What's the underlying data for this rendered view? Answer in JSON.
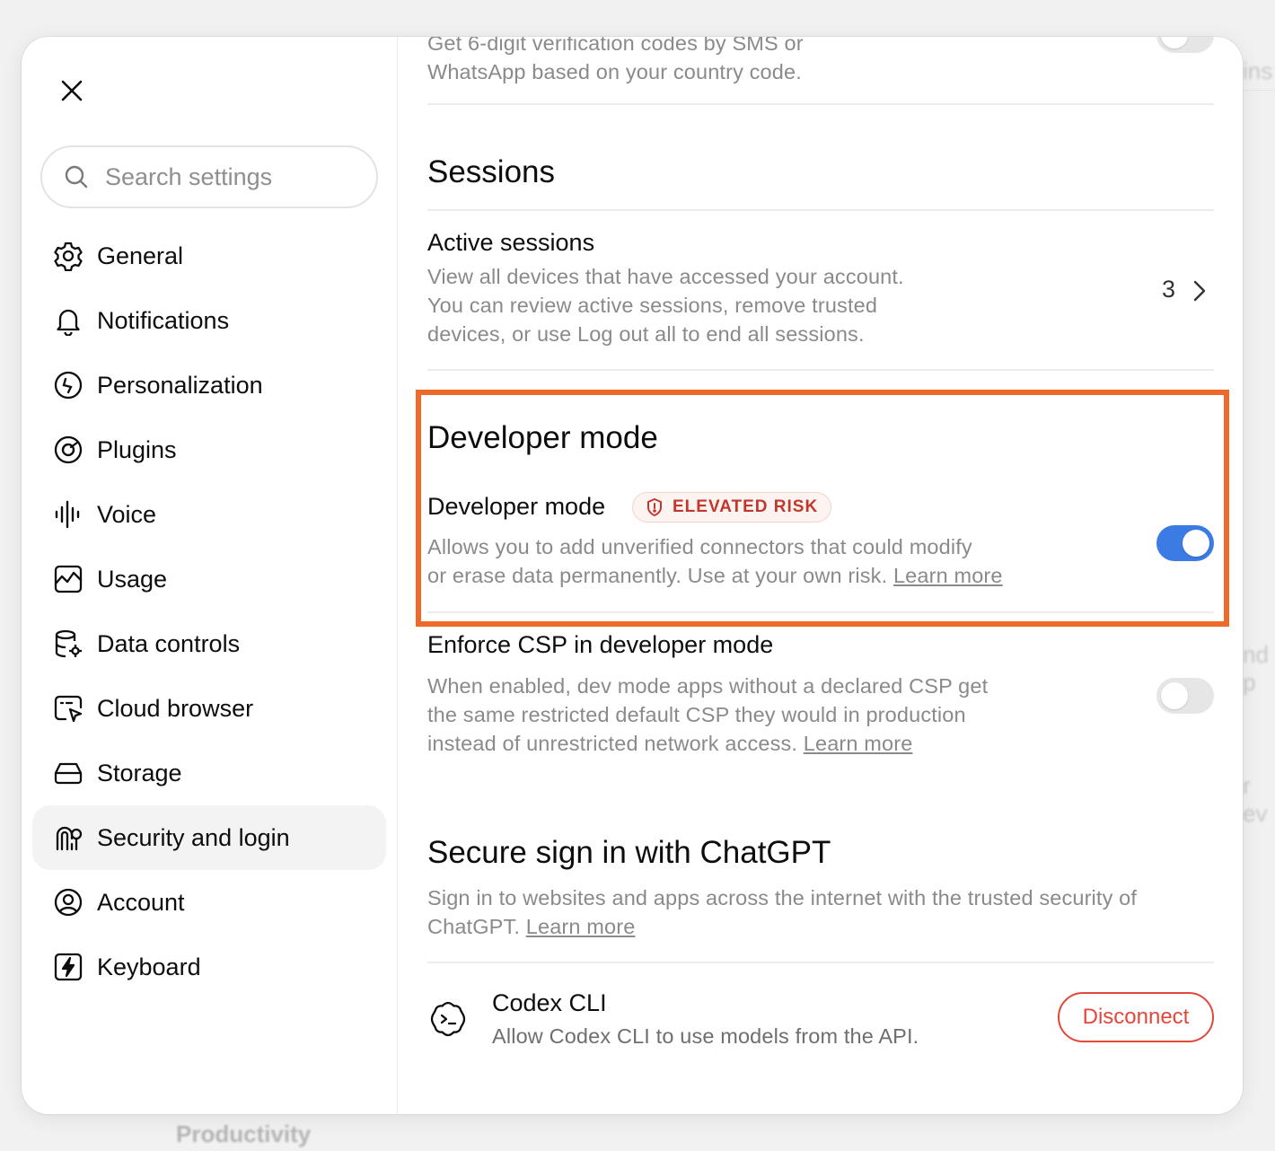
{
  "background": {
    "peek_left": "Productivity",
    "peek_right_top": "ins",
    "peek_right_mid": "nd p",
    "peek_right_low": "r ev"
  },
  "sidebar": {
    "search_placeholder": "Search settings",
    "items": [
      {
        "label": "General",
        "icon": "gear-icon"
      },
      {
        "label": "Notifications",
        "icon": "bell-icon"
      },
      {
        "label": "Personalization",
        "icon": "personalization-icon"
      },
      {
        "label": "Plugins",
        "icon": "plugins-icon"
      },
      {
        "label": "Voice",
        "icon": "waveform-icon"
      },
      {
        "label": "Usage",
        "icon": "usage-chart-icon"
      },
      {
        "label": "Data controls",
        "icon": "database-gear-icon"
      },
      {
        "label": "Cloud browser",
        "icon": "cloud-browser-icon"
      },
      {
        "label": "Storage",
        "icon": "storage-drive-icon"
      },
      {
        "label": "Security and login",
        "icon": "security-icon",
        "active": true
      },
      {
        "label": "Account",
        "icon": "account-icon"
      },
      {
        "label": "Keyboard",
        "icon": "keyboard-bolt-icon"
      }
    ]
  },
  "content": {
    "mfa_desc_line1": "Get 6-digit verification codes by SMS or",
    "mfa_desc_line2": "WhatsApp based on your country code.",
    "sessions": {
      "heading": "Sessions",
      "title": "Active sessions",
      "desc_line1": "View all devices that have accessed your account.",
      "desc_line2": "You can review active sessions, remove trusted",
      "desc_line3": "devices, or use Log out all to end all sessions.",
      "count": "3"
    },
    "developer": {
      "heading": "Developer mode",
      "title": "Developer mode",
      "badge": "ELEVATED RISK",
      "desc_line1": "Allows you to add unverified connectors that could modify",
      "desc_line2": "or erase data permanently. Use at your own risk.",
      "learn_more": "Learn more",
      "enabled": true
    },
    "csp": {
      "title": "Enforce CSP in developer mode",
      "desc_line1": "When enabled, dev mode apps without a declared CSP get",
      "desc_line2": "the same restricted default CSP they would in production",
      "desc_line3": "instead of unrestricted network access.",
      "learn_more": "Learn more",
      "enabled": false
    },
    "secure_signin": {
      "heading": "Secure sign in with ChatGPT",
      "desc_line1": "Sign in to websites and apps across the internet with the trusted security of",
      "desc_line2": "ChatGPT.",
      "learn_more": "Learn more"
    },
    "codex": {
      "title": "Codex CLI",
      "desc": "Allow Codex CLI to use models from the API.",
      "button": "Disconnect"
    }
  },
  "colors": {
    "accent_blue": "#3c7be4",
    "danger_red": "#e3473b",
    "highlight_orange": "#ee6a2a"
  }
}
